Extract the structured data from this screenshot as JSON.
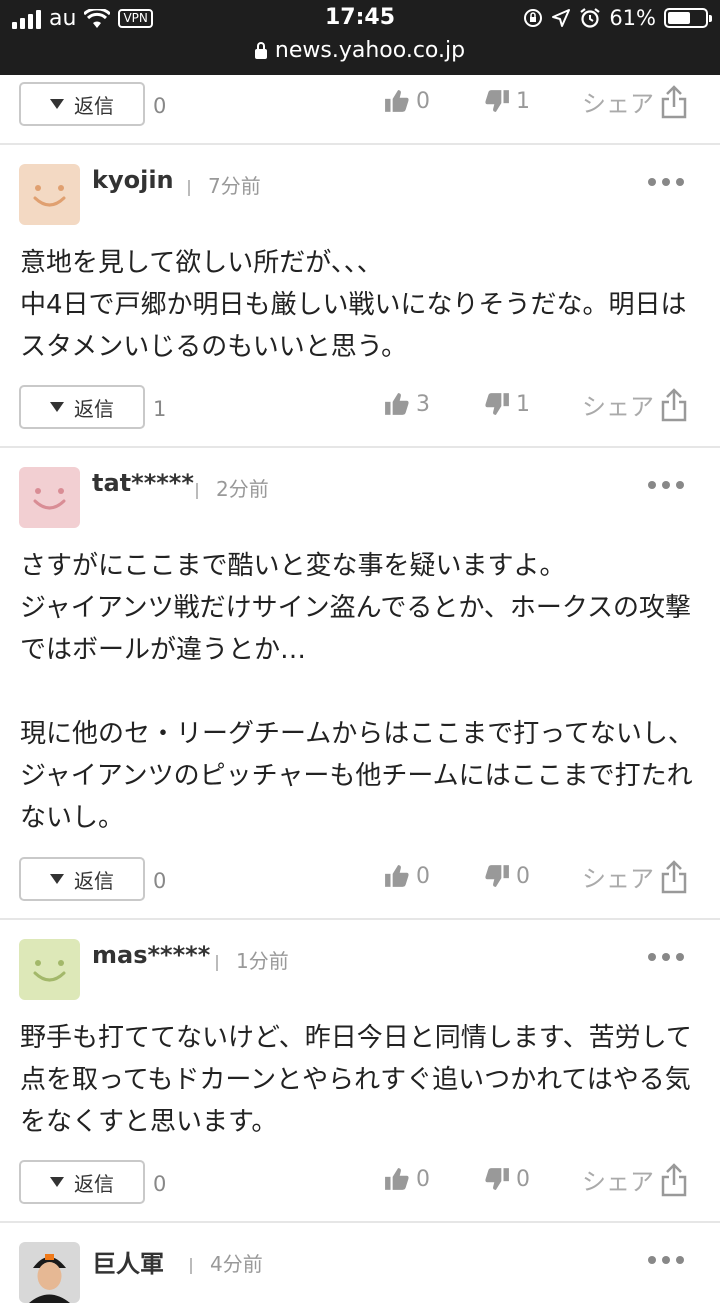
{
  "status_bar": {
    "carrier": "au",
    "vpn": "VPN",
    "time": "17:45",
    "battery": "61%",
    "battery_level": 0.61,
    "url": "news.yahoo.co.jp"
  },
  "top_actions": {
    "reply_label": "返信",
    "reply_count": "0",
    "likes": "0",
    "dislikes": "1",
    "share_label": "シェア"
  },
  "comments": [
    {
      "user": "kyojin",
      "time": "7分前",
      "avatar_color": "#f3d9c3",
      "avatar_face": "#e0a070",
      "text": "意地を見して欲しい所だが、、、\n中4日で戸郷か明日も厳しい戦いになりそうだな。明日はスタメンいじるのもいいと思う。",
      "reply_label": "返信",
      "reply_count": "1",
      "likes": "3",
      "dislikes": "1",
      "share_label": "シェア"
    },
    {
      "user": "tat*****",
      "time": "2分前",
      "avatar_color": "#f2cfd2",
      "avatar_face": "#d98d95",
      "text1": "さすがにここまで酷いと変な事を疑いますよ。\nジャイアンツ戦だけサイン盗んでるとか、ホークスの攻撃ではボールが違うとか…",
      "text2": "現に他のセ・リーグチームからはここまで打ってないし、ジャイアンツのピッチャーも他チームにはここまで打たれないし。",
      "reply_label": "返信",
      "reply_count": "0",
      "likes": "0",
      "dislikes": "0",
      "share_label": "シェア"
    },
    {
      "user": "mas*****",
      "time": "1分前",
      "avatar_color": "#dde8b8",
      "avatar_face": "#a3b86a",
      "text": "野手も打ててないけど、昨日今日と同情します、苦労して点を取ってもドカーンとやられすぐ追いつかれてはやる気をなくすと思います。",
      "reply_label": "返信",
      "reply_count": "0",
      "likes": "0",
      "dislikes": "0",
      "share_label": "シェア"
    },
    {
      "user": "巨人軍",
      "time": "4分前"
    }
  ],
  "colors": {
    "status_bg": "#1e1e1e",
    "separator": "#e6e6e6",
    "icon_gray": "#999999"
  }
}
